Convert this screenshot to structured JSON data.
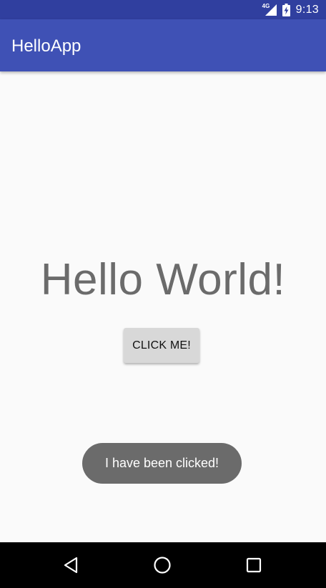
{
  "status_bar": {
    "network_type": "4G",
    "time": "9:13",
    "icons": [
      "signal-icon",
      "battery-charging-icon"
    ],
    "color": "#303f9f"
  },
  "app_bar": {
    "title": "HelloApp",
    "color": "#3f51b5"
  },
  "main": {
    "hello_text": "Hello World!",
    "button_label": "CLICK ME!"
  },
  "toast": {
    "message": "I have been clicked!"
  },
  "nav_bar": {
    "icons": [
      "back-icon",
      "home-icon",
      "recents-icon"
    ]
  }
}
